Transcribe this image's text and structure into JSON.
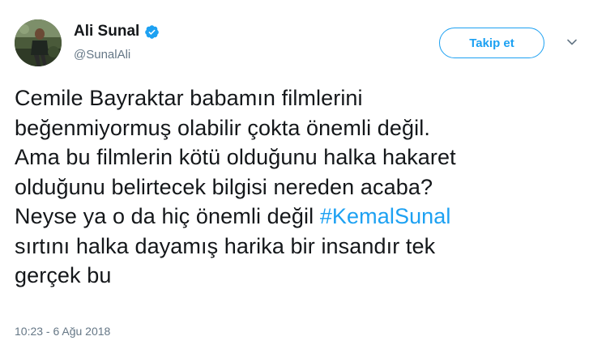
{
  "author": {
    "display_name": "Ali Sunal",
    "username": "@SunalAli",
    "verified": true,
    "avatar_icon": "profile-photo"
  },
  "actions": {
    "follow_label": "Takip et",
    "menu_icon": "chevron-down-icon"
  },
  "tweet": {
    "lines": [
      "Cemile Bayraktar babamın filmlerini",
      "beğenmiyormuş olabilir çokta önemli değil.",
      "Ama bu filmlerin kötü olduğunu halka hakaret",
      "olduğunu belirtecek bilgisi nereden acaba?"
    ],
    "line5_prefix": "Neyse ya o da hiç önemli değil ",
    "hashtag": "#KemalSunal",
    "lines_after": [
      "sırtını halka dayamış harika bir insandır tek",
      "gerçek bu"
    ],
    "timestamp": "10:23 - 6 Ağu 2018"
  },
  "colors": {
    "accent": "#1da1f2",
    "text": "#14171a",
    "muted": "#657786"
  }
}
